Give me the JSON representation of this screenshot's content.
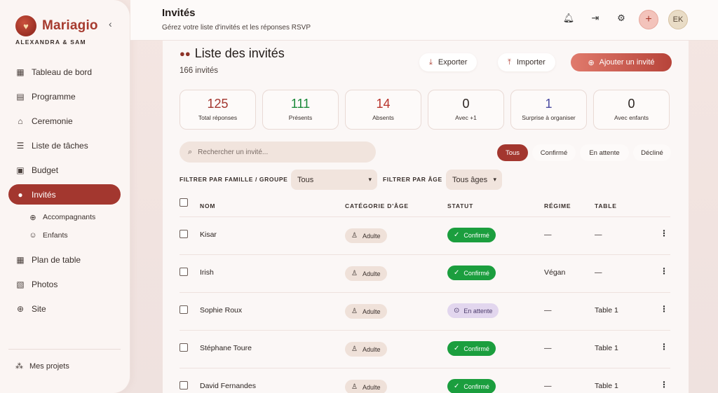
{
  "app": {
    "brand": "Mariagio",
    "couple": "ALEXANDRA & SAM"
  },
  "sidebar": {
    "items": [
      {
        "label": "Tableau de bord",
        "icon": "dashboard-icon"
      },
      {
        "label": "Programme",
        "icon": "calendar-icon"
      },
      {
        "label": "Ceremonie",
        "icon": "ceremony-icon"
      },
      {
        "label": "Liste de tâches",
        "icon": "checklist-icon"
      },
      {
        "label": "Budget",
        "icon": "wallet-icon"
      },
      {
        "label": "Invités",
        "icon": "guests-icon",
        "active": true
      },
      {
        "label": "Plan de table",
        "icon": "table-plan-icon"
      },
      {
        "label": "Photos",
        "icon": "photos-icon"
      },
      {
        "label": "Site",
        "icon": "globe-icon"
      }
    ],
    "subitems": [
      {
        "label": "Accompagnants",
        "icon": "person-add-icon"
      },
      {
        "label": "Enfants",
        "icon": "child-icon"
      }
    ],
    "projects_label": "Mes projets"
  },
  "header": {
    "title": "Invités",
    "subtitle": "Gérez votre liste d'invités et les réponses RSVP",
    "avatar_initials": "EK",
    "accent": "#a3372f"
  },
  "main": {
    "list_title": "Liste des invités",
    "count": "166 invités",
    "export_label": "Exporter",
    "import_label": "Importer",
    "add_label": "Ajouter un invité",
    "stats": [
      {
        "value": "125",
        "label": "Total réponses",
        "color": "#a3372f"
      },
      {
        "value": "111",
        "label": "Présents",
        "color": "#1b8a3a"
      },
      {
        "value": "14",
        "label": "Absents",
        "color": "#b8332b"
      },
      {
        "value": "0",
        "label": "Avec +1",
        "color": "#231c19"
      },
      {
        "value": "1",
        "label": "Surprise à organiser",
        "color": "#4a4aa0"
      },
      {
        "value": "0",
        "label": "Avec enfants",
        "color": "#231c19"
      }
    ],
    "search_placeholder": "Rechercher un invité...",
    "status_filters": [
      "Tous",
      "Confirmé",
      "En attente",
      "Décliné"
    ],
    "family_filter_label": "FILTRER PAR FAMILLE / GROUPE",
    "family_filter_value": "Tous",
    "age_filter_label": "FILTRER PAR ÂGE",
    "age_filter_value": "Tous âges",
    "columns": [
      "NOM",
      "CATÉGORIE D'ÂGE",
      "STATUT",
      "RÉGIME",
      "TABLE"
    ],
    "rows": [
      {
        "name": "Kisar",
        "age": "Adulte",
        "status": "Confirmé",
        "diet": "—",
        "table": "—"
      },
      {
        "name": "Irish",
        "age": "Adulte",
        "status": "Confirmé",
        "diet": "Végan",
        "table": "—"
      },
      {
        "name": "Sophie Roux",
        "age": "Adulte",
        "status": "En attente",
        "diet": "—",
        "table": "Table 1"
      },
      {
        "name": "Stéphane Toure",
        "age": "Adulte",
        "status": "Confirmé",
        "diet": "—",
        "table": "Table 1"
      },
      {
        "name": "David Fernandes",
        "age": "Adulte",
        "status": "Confirmé",
        "diet": "—",
        "table": "Table 1"
      }
    ]
  }
}
